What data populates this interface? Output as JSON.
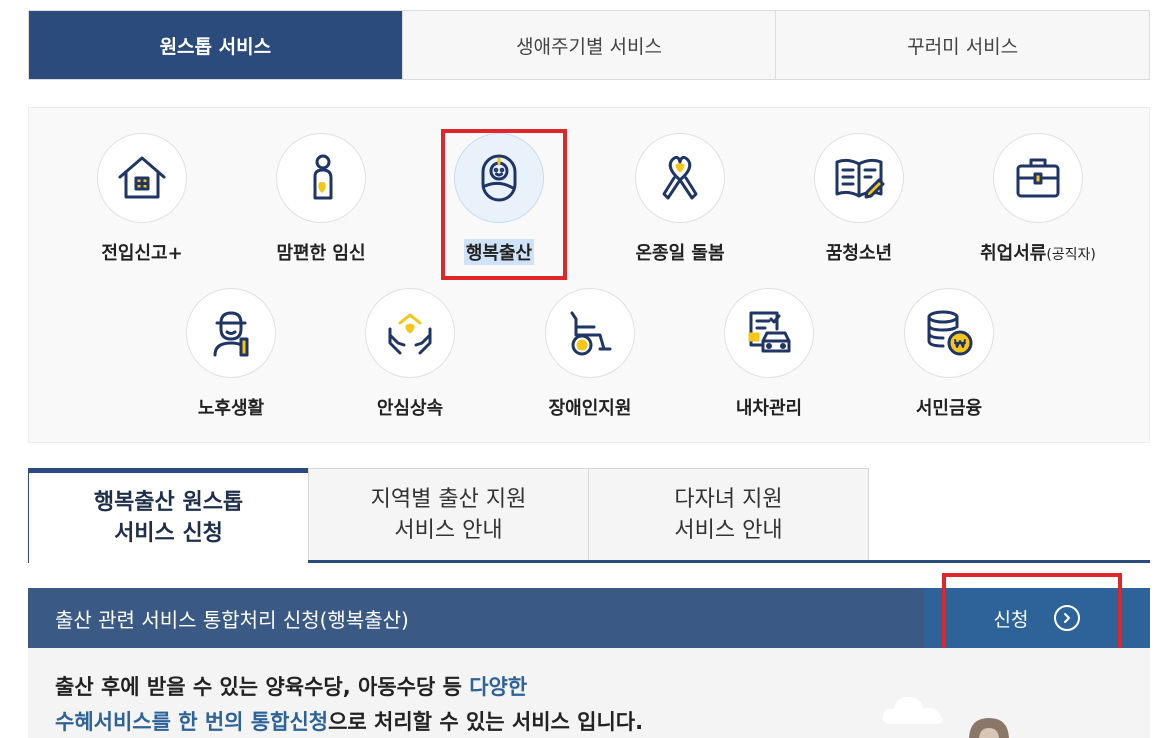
{
  "top_tabs": [
    "원스톱 서비스",
    "생애주기별 서비스",
    "꾸러미 서비스"
  ],
  "categories": [
    {
      "label": "전입신고+",
      "icon": "house-icon"
    },
    {
      "label": "맘편한 임신",
      "icon": "pregnant-icon"
    },
    {
      "label": "행복출산",
      "icon": "baby-icon"
    },
    {
      "label": "온종일 돌봄",
      "icon": "ribbon-heart-icon"
    },
    {
      "label": "꿈청소년",
      "icon": "open-book-icon"
    },
    {
      "label": "취업서류",
      "label_suffix": "(공직자)",
      "icon": "briefcase-icon"
    },
    {
      "label": "노후생활",
      "icon": "elder-icon"
    },
    {
      "label": "안심상속",
      "icon": "hands-house-icon"
    },
    {
      "label": "장애인지원",
      "icon": "wheelchair-icon"
    },
    {
      "label": "내차관리",
      "icon": "car-document-icon"
    },
    {
      "label": "서민금융",
      "icon": "coins-icon"
    }
  ],
  "sub_tabs": [
    {
      "line1": "행복출산 원스톱",
      "line2": "서비스 신청"
    },
    {
      "line1": "지역별 출산 지원",
      "line2": "서비스 안내"
    },
    {
      "line1": "다자녀 지원",
      "line2": "서비스 안내"
    }
  ],
  "service": {
    "title": "출산 관련 서비스 통합처리 신청(행복출산)",
    "apply_label": "신청"
  },
  "description": {
    "line1_plain": "출산 후에 받을 수 있는 양육수당, 아동수당 등 ",
    "line1_blue": "다양한",
    "line2_blue": "수혜서비스를 한 번의 통합신청",
    "line2_plain": "으로 처리할 수 있는 서비스 입니다."
  },
  "colors": {
    "navy": "#2b4b7d",
    "bar": "#3a5a85",
    "apply": "#2e6399",
    "icon_stroke": "#1f3566",
    "icon_accent": "#f5c518",
    "highlight_red": "#e0262b"
  }
}
